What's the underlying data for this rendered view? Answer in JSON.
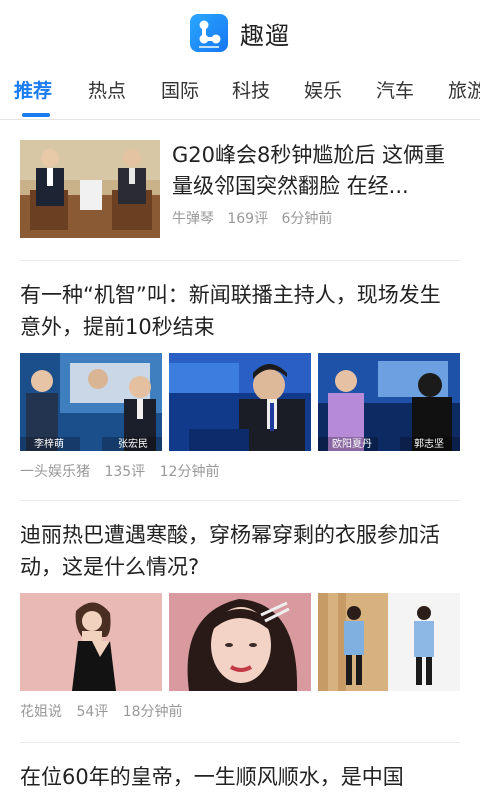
{
  "header": {
    "title": "趣遛",
    "logo_icon": "app-logo-icon",
    "brand_color": "#1a7cf0"
  },
  "tabs": [
    {
      "label": "推荐",
      "active": true
    },
    {
      "label": "热点",
      "active": false
    },
    {
      "label": "国际",
      "active": false
    },
    {
      "label": "科技",
      "active": false
    },
    {
      "label": "娱乐",
      "active": false
    },
    {
      "label": "汽车",
      "active": false
    },
    {
      "label": "旅游",
      "active": false
    }
  ],
  "articles": [
    {
      "title": "G20峰会8秒钟尴尬后 这俩重量级邻国突然翻脸 在经...",
      "source": "牛弹琴",
      "comments": "169评",
      "time": "6分钟前",
      "layout": "single-thumb"
    },
    {
      "title": "有一种“机智”叫：新闻联播主持人，现场发生意外，提前10秒结束",
      "source": "一头娱乐猪",
      "comments": "135评",
      "time": "12分钟前",
      "layout": "three-thumbs",
      "captions": [
        "李梓萌",
        "张宏民",
        "欧阳夏丹",
        "郭志坚"
      ]
    },
    {
      "title": "迪丽热巴遭遇寒酸，穿杨幂穿剩的衣服参加活动，这是什么情况?",
      "source": "花姐说",
      "comments": "54评",
      "time": "18分钟前",
      "layout": "three-thumbs"
    },
    {
      "title": "在位60年的皇帝，一生顺风顺水，是中国",
      "layout": "partial"
    }
  ]
}
